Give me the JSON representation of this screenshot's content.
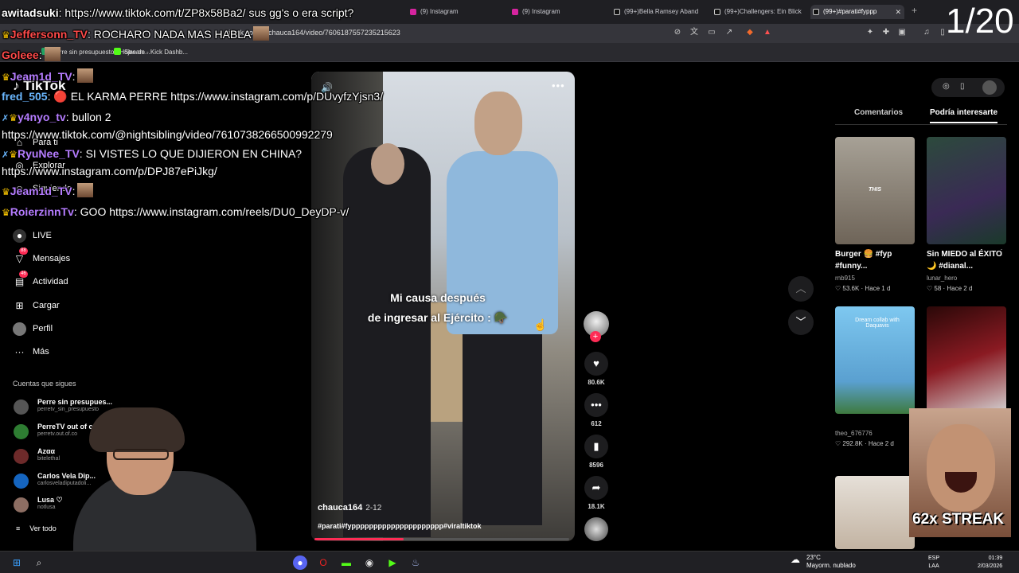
{
  "counter": "1/20",
  "browser": {
    "tabs": [
      {
        "label": "(9) Instagram"
      },
      {
        "label": "(9) Instagram"
      },
      {
        "label": "(99+)Bella Ramsey Aband"
      },
      {
        "label": "(99+)Challengers: Ein Blick"
      },
      {
        "label": "(99+)#parati#fyppp"
      }
    ],
    "url": "tiktok.com/@chauca164/video/7606187557235215623",
    "bookmarks": [
      {
        "label": "Perre sin presupuesto - Hojas de..."
      },
      {
        "label": "Stream - Kick Dashb..."
      }
    ]
  },
  "sidebar": {
    "logo": "TikTok",
    "items": [
      {
        "label": "Para ti"
      },
      {
        "label": "Explorar"
      },
      {
        "label": "Siguiendo"
      },
      {
        "label": "LIVE"
      },
      {
        "label": "Mensajes",
        "badge": "88"
      },
      {
        "label": "Actividad",
        "badge": "46"
      },
      {
        "label": "Cargar"
      },
      {
        "label": "Perfil"
      },
      {
        "label": "Más"
      }
    ],
    "following_title": "Cuentas que sigues",
    "following": [
      {
        "name": "Perre sin presupues...",
        "handle": "perretv_sin_presupuesto"
      },
      {
        "name": "PerreTV out of co...",
        "handle": "perretv.out.of.co"
      },
      {
        "name": "Azαα",
        "handle": "bitelethal"
      },
      {
        "name": "Carlos Vela Dip...",
        "handle": "carlosveladiputadoli..."
      },
      {
        "name": "Lusa ♡",
        "handle": "notlusa"
      }
    ],
    "see_all": "Ver todo"
  },
  "video": {
    "caption_line1": "Mi causa después",
    "caption_line2": "de ingresar al Ejército : 🪖",
    "author": "chauca164",
    "date": "2-12",
    "hashtags": "#parati#fyppppppppppppppppppppp#viraltiktok",
    "progress": 0.35
  },
  "actions": {
    "likes": "80.6K",
    "comments": "612",
    "saves": "8596",
    "shares": "18.1K"
  },
  "right_panel": {
    "tabs": [
      {
        "label": "Comentarios"
      },
      {
        "label": "Podría interesarte"
      }
    ],
    "cards": [
      {
        "title": "Burger 🍔 #fyp #funny...",
        "user": "rnb915",
        "stats": "♡ 53.6K · Hace 1 d",
        "label": "THIS"
      },
      {
        "title": "Sin MIEDO al ÉXITO 🌙 #dianal...",
        "user": "lunar_hero",
        "stats": "♡ 58 · Hace 2 d",
        "label": ""
      },
      {
        "title": "",
        "user": "theo_676776",
        "stats": "♡ 292.8K · Hace 2 d",
        "label": "Dream collab with Daquavis"
      },
      {
        "title": "",
        "user": "",
        "stats": "",
        "label": ""
      }
    ]
  },
  "chat": [
    {
      "user": "awitadsuki",
      "text": ": https://www.tiktok.com/t/ZP8x58Ba2/ sus gg's o era script?",
      "color": "#ffffff"
    },
    {
      "user": "Jeffersonn_TV",
      "text": ": ROCHARO NADA MAS HABLA",
      "color": "#ff4a4a"
    },
    {
      "user": "Goleee",
      "text": ":",
      "color": "#ff4a4a"
    },
    {
      "user": "Jeam1d_TV",
      "text": ":",
      "color": "#b57cff"
    },
    {
      "user": "fred_505",
      "text": ": 🔴 EL KARMA PERRE https://www.instagram.com/p/DUvyfzYjsn3/",
      "color": "#6ab7ff"
    },
    {
      "user": "y4nyo_tv",
      "text": ": bullon 2",
      "color": "#b57cff"
    },
    {
      "user": "",
      "text": "https://www.tiktok.com/@nightsibling/video/7610738266500992279",
      "color": "#ffffff"
    },
    {
      "user": "RyuNee_TV",
      "text": ": SI VISTES LO QUE DIJIERON EN CHINA?",
      "color": "#b57cff"
    },
    {
      "user": "",
      "text": "https://www.instagram.com/p/DPJ87ePiJkg/",
      "color": "#ffffff"
    },
    {
      "user": "Jeam1d_TV",
      "text": ":",
      "color": "#b57cff"
    },
    {
      "user": "RoierzinnTv",
      "text": ": GOO https://www.instagram.com/reels/DU0_DeyDP-v/",
      "color": "#b57cff"
    }
  ],
  "streak": "62x STREAK",
  "taskbar": {
    "weather_temp": "23°C",
    "weather_desc": "Mayorm. nublado",
    "lang1": "ESP",
    "lang2": "LAA",
    "time": "01:39",
    "date": "2/03/2026"
  },
  "colors": {
    "accent": "#fe2c55",
    "background": "#000000"
  }
}
